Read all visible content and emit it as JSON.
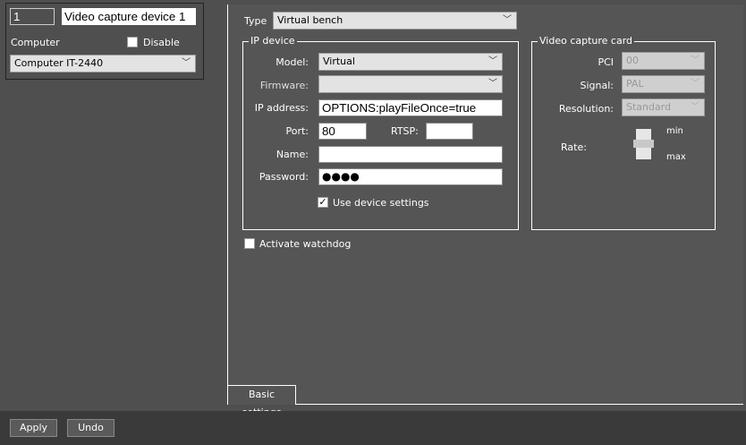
{
  "device": {
    "id": "1",
    "name": "Video capture device 1",
    "computer_label": "Computer",
    "disable_label": "Disable",
    "computer": "Computer IT-2440"
  },
  "main": {
    "type_label": "Type",
    "type": "Virtual bench",
    "ip_device": {
      "title": "IP device",
      "model_label": "Model:",
      "model": "Virtual",
      "firmware_label": "Firmware:",
      "firmware": "",
      "ip_label": "IP address:",
      "ip": "OPTIONS:playFileOnce=true",
      "port_label": "Port:",
      "port": "80",
      "rtsp_label": "RTSP:",
      "rtsp": "",
      "name_label": "Name:",
      "name": "",
      "password_label": "Password:",
      "password": "●●●●",
      "use_settings_label": "Use device settings",
      "use_settings_checked": true
    },
    "capture_card": {
      "title": "Video capture card",
      "pci_label": "PCI",
      "pci": "00",
      "signal_label": "Signal:",
      "signal": "PAL",
      "resolution_label": "Resolution:",
      "resolution": "Standard",
      "rate_label": "Rate:",
      "rate_min": "min",
      "rate_max": "max"
    },
    "watchdog_label": "Activate watchdog",
    "watchdog_checked": false,
    "tab": "Basic settings"
  },
  "footer": {
    "apply": "Apply",
    "undo": "Undo"
  }
}
